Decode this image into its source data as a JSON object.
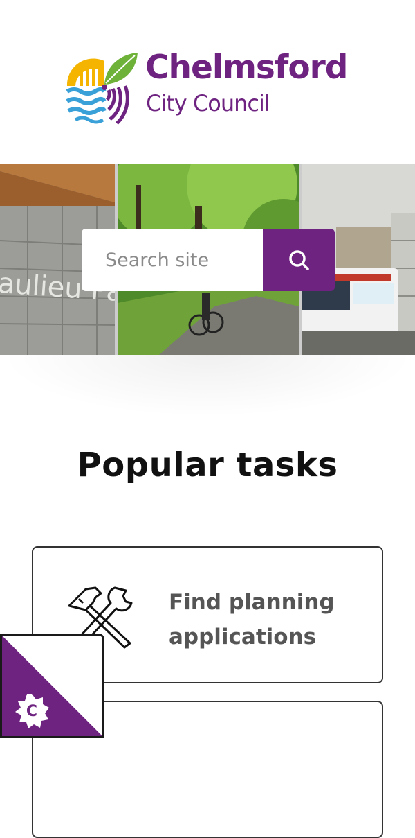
{
  "header": {
    "logo_line1": "Chelmsford",
    "logo_line2": "City Council",
    "logo_icon": "chelmsford-logo-mark"
  },
  "search": {
    "placeholder": "Search site",
    "button_icon": "search-icon"
  },
  "popular": {
    "title": "Popular tasks",
    "tasks": [
      {
        "label": "Find planning applications",
        "icon": "hammer-wrench-icon"
      },
      {
        "label": "",
        "icon": ""
      }
    ]
  },
  "cookie_badge": {
    "letter": "C",
    "icon": "cookie-settings-icon"
  },
  "colors": {
    "brand_purple": "#6e2381",
    "logo_yellow": "#f4b400",
    "logo_green": "#6fb23a",
    "logo_blue": "#3aa0d8"
  }
}
